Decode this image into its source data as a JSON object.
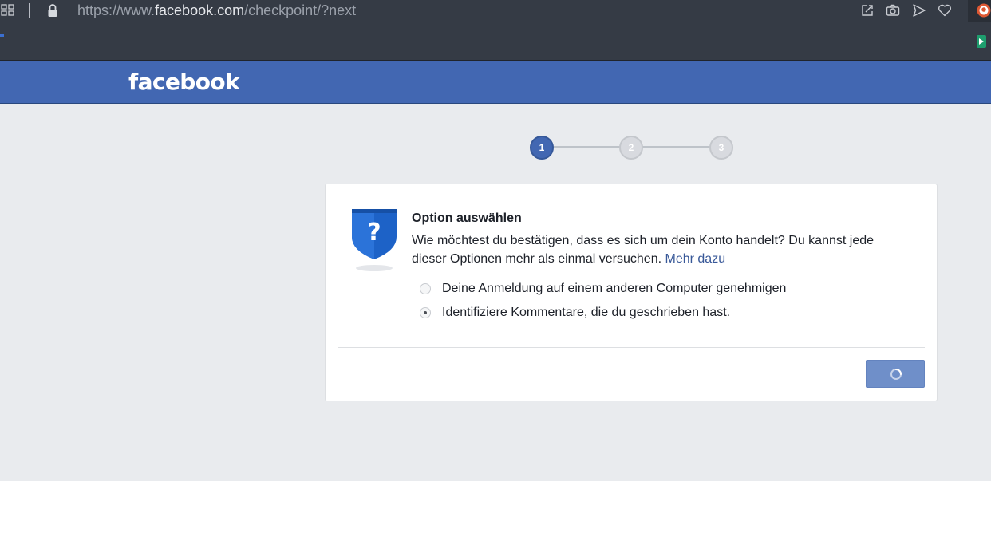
{
  "browser": {
    "url_scheme": "https://www.",
    "url_host": "facebook.com",
    "url_path": "/checkpoint/?next",
    "icons": [
      "apps-grid-icon",
      "lock-icon",
      "share-edit-icon",
      "camera-icon",
      "send-icon",
      "heart-icon",
      "duckduckgo-extension-icon"
    ]
  },
  "header": {
    "logo_text": "facebook",
    "color": "#4267b2"
  },
  "stepper": {
    "steps": [
      {
        "label": "1",
        "state": "active"
      },
      {
        "label": "2",
        "state": "inactive"
      },
      {
        "label": "3",
        "state": "inactive"
      }
    ]
  },
  "card": {
    "title": "Option auswählen",
    "description": "Wie möchtest du bestätigen, dass es sich um dein Konto handelt? Du kannst jede dieser Optionen mehr als einmal versuchen.",
    "more_link": "Mehr dazu",
    "options": [
      {
        "label": "Deine Anmeldung auf einem anderen Computer genehmigen",
        "selected": false
      },
      {
        "label": "Identifiziere Kommentare, die du geschrieben hast.",
        "selected": true
      }
    ],
    "continue_button_state": "loading"
  }
}
